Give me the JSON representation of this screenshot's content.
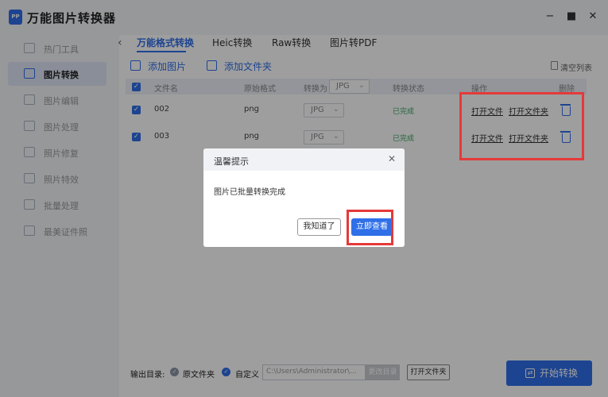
{
  "app": {
    "logo_text": "PP",
    "title": "万能图片转换器",
    "window_controls": [
      "minimize-icon",
      "maximize-icon",
      "close-icon"
    ]
  },
  "sidebar": {
    "items": [
      {
        "label": "热门工具",
        "icon": "fire-icon",
        "active": false
      },
      {
        "label": "图片转换",
        "icon": "convert-icon",
        "active": true
      },
      {
        "label": "图片编辑",
        "icon": "edit-icon",
        "active": false
      },
      {
        "label": "图片处理",
        "icon": "process-icon",
        "active": false
      },
      {
        "label": "照片修复",
        "icon": "repair-icon",
        "active": false
      },
      {
        "label": "照片特效",
        "icon": "effect-icon",
        "active": false
      },
      {
        "label": "批量处理",
        "icon": "batch-icon",
        "active": false
      },
      {
        "label": "最美证件照",
        "icon": "id-photo-icon",
        "active": false
      }
    ]
  },
  "tabs": [
    {
      "label": "万能格式转换",
      "active": true
    },
    {
      "label": "Heic转换",
      "active": false
    },
    {
      "label": "Raw转换",
      "active": false
    },
    {
      "label": "图片转PDF",
      "active": false
    }
  ],
  "toolbar": {
    "add_image": "添加图片",
    "add_folder": "添加文件夹",
    "clear_list": "清空列表"
  },
  "table": {
    "headers": {
      "filename": "文件名",
      "original_format": "原始格式",
      "convert_to": "转换为",
      "convert_to_value": "JPG",
      "status": "转换状态",
      "actions": "操作",
      "delete": "删除"
    },
    "rows": [
      {
        "filename": "002",
        "original_format": "png",
        "target": "JPG",
        "status": "已完成",
        "open_file": "打开文件",
        "open_folder": "打开文件夹"
      },
      {
        "filename": "003",
        "original_format": "png",
        "target": "JPG",
        "status": "已完成",
        "open_file": "打开文件",
        "open_folder": "打开文件夹"
      }
    ]
  },
  "dialog": {
    "title": "温馨提示",
    "message": "图片已批量转换完成",
    "ok_label": "我知道了",
    "view_label": "立即查看"
  },
  "bottom": {
    "output_label": "输出目录:",
    "option_original": "原文件夹",
    "option_custom": "自定义",
    "path_value": "C:\\Users\\Administrator\\...",
    "change_dir": "更改目录",
    "open_folder": "打开文件夹",
    "start": "开始转换"
  },
  "colors": {
    "accent": "#2f6fe8",
    "highlight": "#e5393a",
    "done": "#3aa563"
  }
}
